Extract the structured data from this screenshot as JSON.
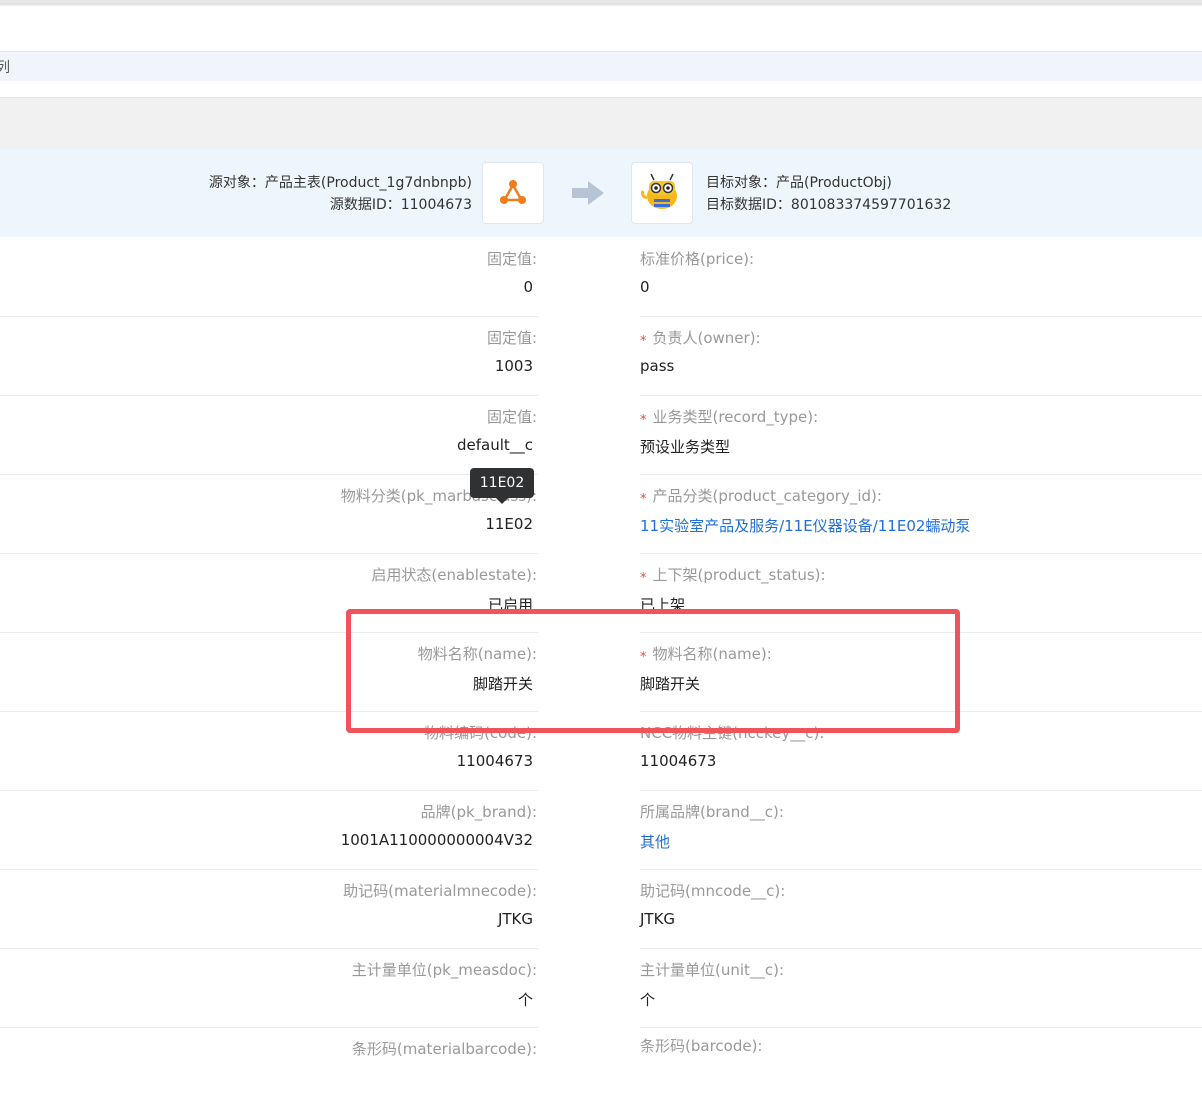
{
  "crumb": "列",
  "mapping": {
    "source_object": "源对象：产品主表(Product_1g7dnbnpb)",
    "source_id": "源数据ID：11004673",
    "target_object": "目标对象：产品(ProductObj)",
    "target_id": "目标数据ID：801083374597701632"
  },
  "tooltip": "11E02",
  "rows": [
    {
      "left_label": "固定值:",
      "left_value": "0",
      "right_label": "标准价格(price):",
      "right_value": "0",
      "required": false,
      "right_link": false
    },
    {
      "left_label": "固定值:",
      "left_value": "1003",
      "right_label": "负责人(owner):",
      "right_value": "pass",
      "required": true,
      "right_link": false
    },
    {
      "left_label": "固定值:",
      "left_value": "default__c",
      "right_label": "业务类型(record_type):",
      "right_value": "预设业务类型",
      "required": true,
      "right_link": false
    },
    {
      "left_label": "物料分类(pk_marbasclass):",
      "left_value": "11E02",
      "right_label": "产品分类(product_category_id):",
      "right_value": "11实验室产品及服务/11E仪器设备/11E02蠕动泵",
      "required": true,
      "right_link": true
    },
    {
      "left_label": "启用状态(enablestate):",
      "left_value": "已启用",
      "right_label": "上下架(product_status):",
      "right_value": "已上架",
      "required": true,
      "right_link": false
    },
    {
      "left_label": "物料名称(name):",
      "left_value": "脚踏开关",
      "right_label": "物料名称(name):",
      "right_value": "脚踏开关",
      "required": true,
      "right_link": false
    },
    {
      "left_label": "物料编码(code):",
      "left_value": "11004673",
      "right_label": "NCC物料主键(ncckey__c):",
      "right_value": "11004673",
      "required": false,
      "right_link": false
    },
    {
      "left_label": "品牌(pk_brand):",
      "left_value": "1001A110000000004V32",
      "right_label": "所属品牌(brand__c):",
      "right_value": "其他",
      "required": false,
      "right_link": true
    },
    {
      "left_label": "助记码(materialmnecode):",
      "left_value": "JTKG",
      "right_label": "助记码(mncode__c):",
      "right_value": "JTKG",
      "required": false,
      "right_link": false
    },
    {
      "left_label": "主计量单位(pk_measdoc):",
      "left_value": "个",
      "right_label": "主计量单位(unit__c):",
      "right_value": "个",
      "required": false,
      "right_link": false
    },
    {
      "left_label": "条形码(materialbarcode):",
      "left_value": "",
      "right_label": "条形码(barcode):",
      "right_value": "",
      "required": false,
      "right_link": false
    }
  ]
}
